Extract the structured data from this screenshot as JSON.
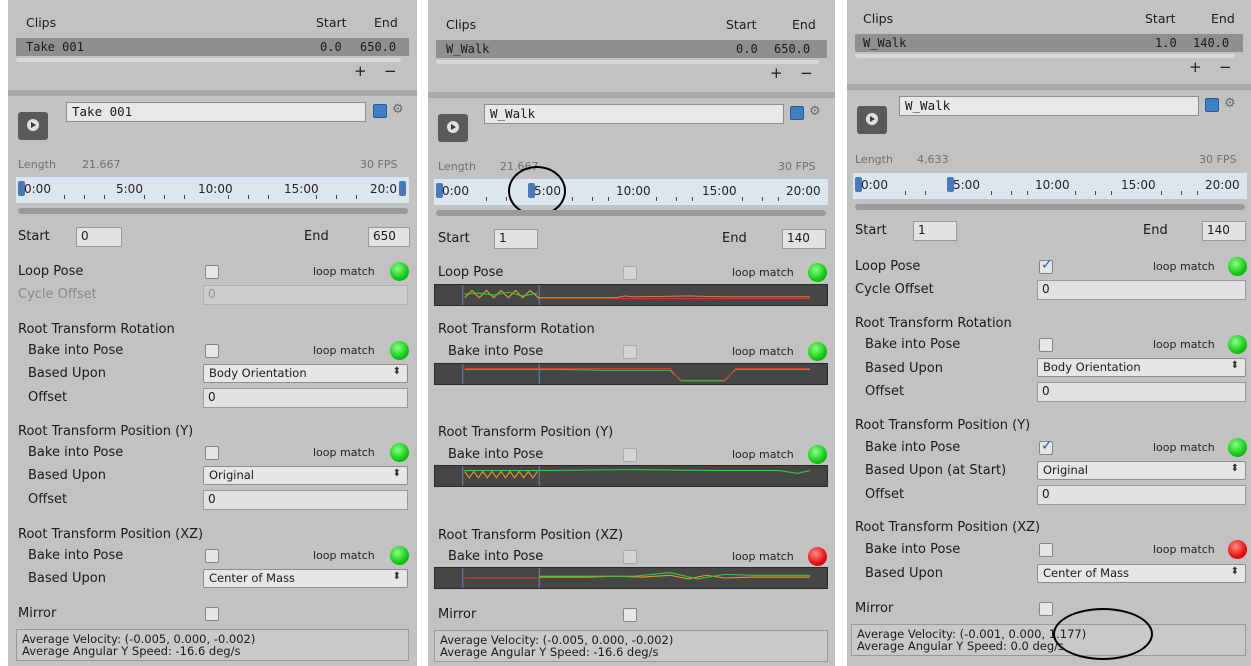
{
  "panels": [
    {
      "clips_header": {
        "label": "Clips",
        "start": "Start",
        "end": "End"
      },
      "clip_row": {
        "name": "Take 001",
        "start": "0.0",
        "end": "650.0"
      },
      "add": "+",
      "remove": "−",
      "clip_name_field": "Take 001",
      "length_label": "Length",
      "length_value": "21.667",
      "fps": "30 FPS",
      "ruler_labels": [
        "0:00",
        "5:00",
        "10:00",
        "15:00",
        "20:0"
      ],
      "start_label": "Start",
      "start_value": "0",
      "end_label": "End",
      "end_value": "650",
      "loop_pose": "Loop Pose",
      "loop_match": "loop match",
      "cycle_offset": "Cycle Offset",
      "cycle_offset_value": "0",
      "rot_title": "Root Transform Rotation",
      "rot_bake": "Bake into Pose",
      "rot_based": "Based Upon",
      "rot_based_value": "Body Orientation",
      "rot_offset": "Offset",
      "rot_offset_value": "0",
      "posy_title": "Root Transform Position (Y)",
      "posy_bake": "Bake into Pose",
      "posy_based": "Based Upon",
      "posy_based_value": "Original",
      "posy_offset": "Offset",
      "posy_offset_value": "0",
      "posxz_title": "Root Transform Position (XZ)",
      "posxz_bake": "Bake into Pose",
      "posxz_based": "Based Upon",
      "posxz_based_value": "Center of Mass",
      "mirror": "Mirror",
      "avg_velocity": "Average Velocity: (-0.005, 0.000, -0.002)",
      "avg_angular": "Average Angular Y Speed: -16.6 deg/s"
    },
    {
      "clips_header": {
        "label": "Clips",
        "start": "Start",
        "end": "End"
      },
      "clip_row": {
        "name": "W_Walk",
        "start": "0.0",
        "end": "650.0"
      },
      "add": "+",
      "remove": "−",
      "clip_name_field": "W_Walk",
      "length_label": "Length",
      "length_value": "21.667",
      "fps": "30 FPS",
      "ruler_labels": [
        "0:00",
        "5:00",
        "10:00",
        "15:00",
        "20:00"
      ],
      "start_label": "Start",
      "start_value": "1",
      "end_label": "End",
      "end_value": "140",
      "loop_pose": "Loop Pose",
      "loop_match": "loop match",
      "rot_title": "Root Transform Rotation",
      "rot_bake": "Bake into Pose",
      "posy_title": "Root Transform Position (Y)",
      "posy_bake": "Bake into Pose",
      "posxz_title": "Root Transform Position (XZ)",
      "posxz_bake": "Bake into Pose",
      "mirror": "Mirror",
      "avg_velocity": "Average Velocity: (-0.005, 0.000, -0.002)",
      "avg_angular": "Average Angular Y Speed: -16.6 deg/s"
    },
    {
      "clips_header": {
        "label": "Clips",
        "start": "Start",
        "end": "End"
      },
      "clip_row": {
        "name": "W_Walk",
        "start": "1.0",
        "end": "140.0"
      },
      "add": "+",
      "remove": "−",
      "clip_name_field": "W_Walk",
      "length_label": "Length",
      "length_value": "4.633",
      "fps": "30 FPS",
      "ruler_labels": [
        "0:00",
        "5:00",
        "10:00",
        "15:00",
        "20:00"
      ],
      "start_label": "Start",
      "start_value": "1",
      "end_label": "End",
      "end_value": "140",
      "loop_pose": "Loop Pose",
      "loop_match": "loop match",
      "cycle_offset": "Cycle Offset",
      "cycle_offset_value": "0",
      "rot_title": "Root Transform Rotation",
      "rot_bake": "Bake into Pose",
      "rot_based": "Based Upon",
      "rot_based_value": "Body Orientation",
      "rot_offset": "Offset",
      "rot_offset_value": "0",
      "posy_title": "Root Transform Position (Y)",
      "posy_bake": "Bake into Pose",
      "posy_based": "Based Upon (at Start)",
      "posy_based_value": "Original",
      "posy_offset": "Offset",
      "posy_offset_value": "0",
      "posxz_title": "Root Transform Position (XZ)",
      "posxz_bake": "Bake into Pose",
      "posxz_based": "Based Upon",
      "posxz_based_value": "Center of Mass",
      "mirror": "Mirror",
      "avg_velocity": "Average Velocity: (-0.001, 0.000, 1.177)",
      "avg_angular": "Average Angular Y Speed: 0.0 deg/s"
    }
  ],
  "colors": {
    "match_ok": "#12c912",
    "match_bad": "#e60e0e",
    "accent": "#3f7fc4"
  }
}
